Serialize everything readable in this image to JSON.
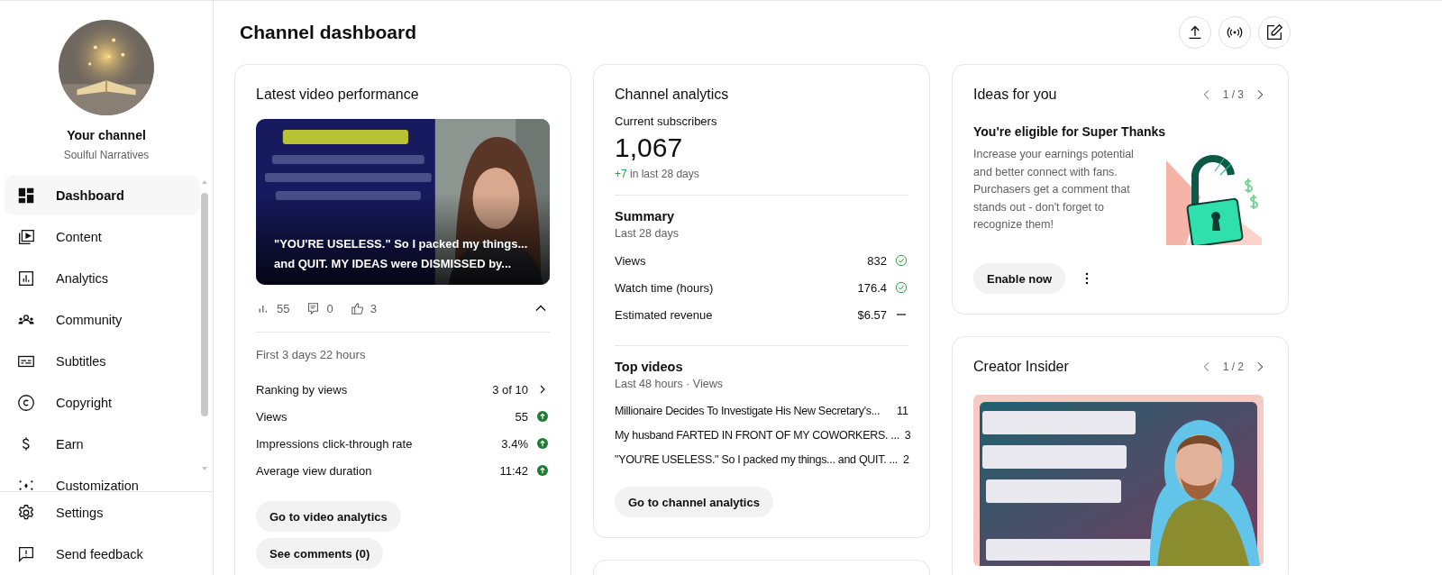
{
  "channel": {
    "heading": "Your channel",
    "name": "Soulful Narratives"
  },
  "nav": [
    {
      "label": "Dashboard",
      "selected": true
    },
    {
      "label": "Content",
      "selected": false
    },
    {
      "label": "Analytics",
      "selected": false
    },
    {
      "label": "Community",
      "selected": false
    },
    {
      "label": "Subtitles",
      "selected": false
    },
    {
      "label": "Copyright",
      "selected": false
    },
    {
      "label": "Earn",
      "selected": false
    },
    {
      "label": "Customization",
      "selected": false
    }
  ],
  "footer_nav": [
    {
      "label": "Settings"
    },
    {
      "label": "Send feedback"
    }
  ],
  "page_title": "Channel dashboard",
  "latest_video": {
    "title": "Latest video performance",
    "video_title": "\"YOU'RE USELESS.\" So I packed my things... and QUIT. MY IDEAS were DISMISSED by...",
    "stats": [
      {
        "value": "55"
      },
      {
        "value": "0"
      },
      {
        "value": "3"
      }
    ],
    "expanded": true,
    "period": "First 3 days 22 hours",
    "metrics": [
      {
        "label": "Ranking by views",
        "value": "3 of 10",
        "kind": "link"
      },
      {
        "label": "Views",
        "value": "55",
        "kind": "up"
      },
      {
        "label": "Impressions click-through rate",
        "value": "3.4%",
        "kind": "up"
      },
      {
        "label": "Average view duration",
        "value": "11:42",
        "kind": "up"
      }
    ],
    "buttons": [
      "Go to video analytics",
      "See comments (0)"
    ]
  },
  "channel_analytics": {
    "title": "Channel analytics",
    "subscribers_label": "Current subscribers",
    "subscribers": "1,067",
    "change": "+7",
    "change_note": "in last 28 days",
    "summary": {
      "title": "Summary",
      "period": "Last 28 days",
      "rows": [
        {
          "label": "Views",
          "value": "832",
          "kind": "check"
        },
        {
          "label": "Watch time (hours)",
          "value": "176.4",
          "kind": "check"
        },
        {
          "label": "Estimated revenue",
          "value": "$6.57",
          "kind": "dash"
        }
      ]
    },
    "top_videos": {
      "title": "Top videos",
      "period": "Last 48 hours · Views",
      "rows": [
        {
          "title": "Millionaire Decides To Investigate His New Secretary's...",
          "views": "11"
        },
        {
          "title": "My husband FARTED IN FRONT OF MY COWORKERS. ...",
          "views": "3"
        },
        {
          "title": "\"YOU'RE USELESS.\" So I packed my things... and QUIT. ...",
          "views": "2"
        }
      ]
    },
    "button": "Go to channel analytics"
  },
  "ideas": {
    "title": "Ideas for you",
    "pager": "1 / 3",
    "heading": "You're eligible for Super Thanks",
    "body": "Increase your earnings potential and better connect with fans. Purchasers get a comment that stands out - don't forget to recognize them!",
    "button": "Enable now"
  },
  "creator_insider": {
    "title": "Creator Insider",
    "pager": "1 / 2"
  }
}
